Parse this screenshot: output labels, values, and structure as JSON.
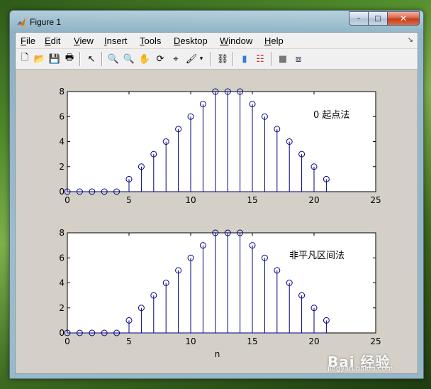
{
  "window": {
    "title": "Figure 1",
    "icon": "matlab-icon"
  },
  "controls": {
    "minimize": "–",
    "maximize": "□",
    "close": "✕"
  },
  "menu": [
    {
      "label": "File",
      "underline": "F"
    },
    {
      "label": "Edit",
      "underline": "E"
    },
    {
      "label": "View",
      "underline": "V"
    },
    {
      "label": "Insert",
      "underline": "I"
    },
    {
      "label": "Tools",
      "underline": "T"
    },
    {
      "label": "Desktop",
      "underline": "D"
    },
    {
      "label": "Window",
      "underline": "W"
    },
    {
      "label": "Help",
      "underline": "H"
    }
  ],
  "menu_dock_glyph": "↘",
  "toolbar": [
    {
      "name": "new-figure-icon",
      "glyph": "🗋"
    },
    {
      "name": "open-file-icon",
      "glyph": "📂"
    },
    {
      "name": "save-icon",
      "glyph": "💾"
    },
    {
      "name": "print-icon",
      "glyph": "🖶"
    },
    {
      "name": "pointer-icon",
      "glyph": "↖"
    },
    {
      "name": "zoom-in-icon",
      "glyph": "🔍"
    },
    {
      "name": "zoom-out-icon",
      "glyph": "🔍"
    },
    {
      "name": "pan-icon",
      "glyph": "✋"
    },
    {
      "name": "rotate-icon",
      "glyph": "⟳"
    },
    {
      "name": "data-cursor-icon",
      "glyph": "⌖"
    },
    {
      "name": "brush-icon",
      "glyph": "🖌"
    },
    {
      "name": "brush-dropdown-icon",
      "glyph": "▾"
    },
    {
      "name": "link-icon",
      "glyph": "⛓"
    },
    {
      "name": "colorbar-icon",
      "glyph": "▮"
    },
    {
      "name": "legend-icon",
      "glyph": "☷"
    },
    {
      "name": "hide-plot-tools-icon",
      "glyph": "■"
    },
    {
      "name": "show-plot-tools-icon",
      "glyph": "⧈"
    }
  ],
  "chart_data": [
    {
      "type": "stem",
      "x": [
        0,
        1,
        2,
        3,
        4,
        5,
        6,
        7,
        8,
        9,
        10,
        11,
        12,
        13,
        14,
        15,
        16,
        17,
        18,
        19,
        20,
        21
      ],
      "values": [
        0,
        0,
        0,
        0,
        0,
        1,
        2,
        3,
        4,
        5,
        6,
        7,
        8,
        8,
        8,
        7,
        6,
        5,
        4,
        3,
        2,
        1
      ],
      "annotation": "0 起点法",
      "xlim": [
        0,
        25
      ],
      "ylim": [
        0,
        8
      ],
      "xticks": [
        0,
        5,
        10,
        15,
        20,
        25
      ],
      "yticks": [
        0,
        2,
        4,
        6,
        8
      ],
      "xlabel": "",
      "grid": false,
      "color": "#000080"
    },
    {
      "type": "stem",
      "x": [
        0,
        1,
        2,
        3,
        4,
        5,
        6,
        7,
        8,
        9,
        10,
        11,
        12,
        13,
        14,
        15,
        16,
        17,
        18,
        19,
        20,
        21
      ],
      "values": [
        0,
        0,
        0,
        0,
        0,
        1,
        2,
        3,
        4,
        5,
        6,
        7,
        8,
        8,
        8,
        7,
        6,
        5,
        4,
        3,
        2,
        1
      ],
      "annotation": "非平凡区间法",
      "xlim": [
        0,
        25
      ],
      "ylim": [
        0,
        8
      ],
      "xticks": [
        0,
        5,
        10,
        15,
        20,
        25
      ],
      "yticks": [
        0,
        2,
        4,
        6,
        8
      ],
      "xlabel": "n",
      "grid": false,
      "color": "#000080"
    }
  ],
  "watermark": {
    "brand": "Bai 经验",
    "url": "jingyan.baidu.com"
  }
}
